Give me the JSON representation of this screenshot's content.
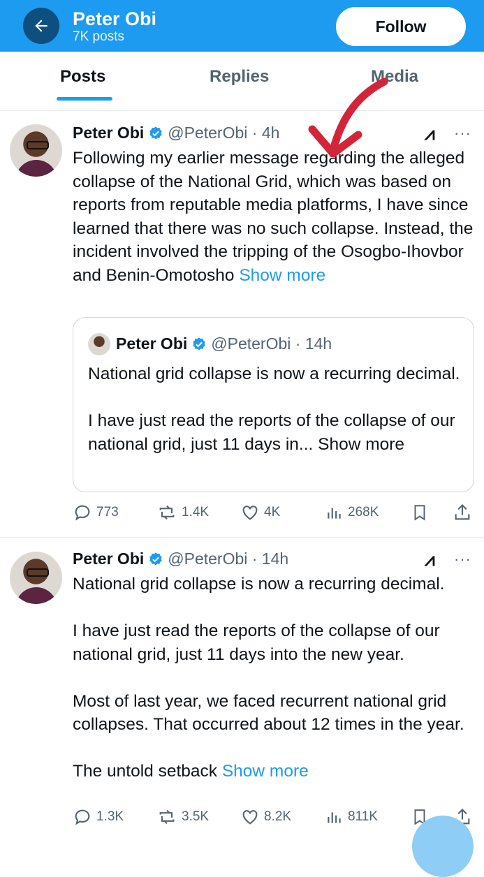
{
  "header": {
    "back_label": "←",
    "name": "Peter Obi",
    "posts_count": "7K posts",
    "follow_label": "Follow"
  },
  "tabs": [
    {
      "label": "Posts",
      "active": true
    },
    {
      "label": "Replies",
      "active": false
    },
    {
      "label": "Media",
      "active": false
    }
  ],
  "tweets": [
    {
      "name": "Peter Obi",
      "handle_time": "@PeterObi · 4h",
      "text": "Following my earlier message regarding the alleged collapse of the National Grid, which was based on reports from reputable media platforms, I have since learned that there was no such collapse. Instead, the incident involved the tripping of the Osogbo-Ihovbor and Benin-Omotosho",
      "show_more": "Show more",
      "quote": {
        "name": "Peter Obi",
        "handle_time": "@PeterObi · 14h",
        "text": "National grid collapse is now a recurring decimal.\n\nI have just read the reports of the collapse of our national grid, just 11 days in...",
        "show_more": "Show more"
      },
      "stats": {
        "replies": "773",
        "reposts": "1.4K",
        "likes": "4K",
        "views": "268K"
      }
    },
    {
      "name": "Peter Obi",
      "handle_time": "@PeterObi · 14h",
      "text": "National grid collapse is now a recurring decimal.\n\nI have just read the reports of the collapse of our national grid, just 11 days into the new year.\n\nMost of last year, we faced recurrent national grid collapses. That occurred about 12 times in the year.\n\nThe untold setback",
      "show_more": "Show more",
      "stats": {
        "replies": "1.3K",
        "reposts": "3.5K",
        "likes": "8.2K",
        "views": "811K"
      }
    }
  ],
  "colors": {
    "accent": "#1d9bf0",
    "annotation_arrow": "#d3253a"
  },
  "icons": [
    "arrow-left-icon",
    "verified-badge-icon",
    "grok-icon",
    "more-icon",
    "reply-icon",
    "repost-icon",
    "like-icon",
    "views-icon",
    "bookmark-icon",
    "share-icon"
  ]
}
